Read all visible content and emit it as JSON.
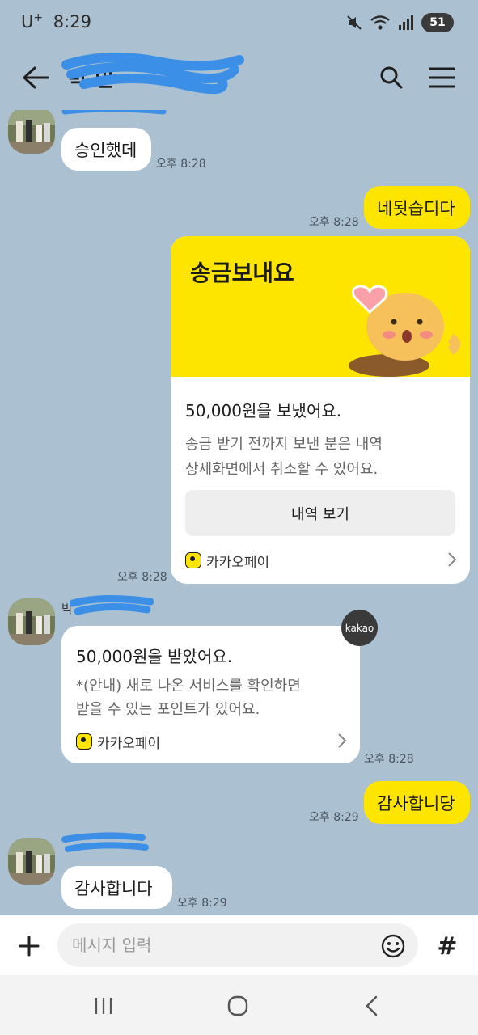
{
  "status_bar": {
    "carrier": "U",
    "carrier_sup": "+",
    "time": "8:29",
    "battery": "51"
  },
  "header": {
    "title": "박 민 "
  },
  "messages": {
    "m1_text": "승인했데",
    "m1_time": "오후 8:28",
    "m2_text": "네됫습디다",
    "m2_time": "오후 8:28",
    "m3_time": "오후 8:28",
    "m4_sender": "박",
    "m4_time": "오후 8:28",
    "m5_text": "감사합니당",
    "m5_time": "오후 8:29",
    "m6_text": "감사합니다",
    "m6_time": "오후 8:29"
  },
  "pay_card": {
    "headline": "송금보내요",
    "amount": "50,000원을 보냈어요.",
    "desc_line1": "송금 받기 전까지 보낸 분은 내역",
    "desc_line2": "상세화면에서 취소할 수 있어요.",
    "button_label": "내역 보기",
    "brand": "카카오페이"
  },
  "recv_card": {
    "badge": "kakao",
    "amount": "50,000원을 받았어요.",
    "desc_line1": "*(안내) 새로 나온 서비스를 확인하면",
    "desc_line2": "받을 수 있는 포인트가 있어요.",
    "brand": "카카오페이"
  },
  "input_bar": {
    "placeholder": "메시지 입력",
    "hash_label": "#"
  },
  "colors": {
    "chat_background": "#abc1d1",
    "outgoing_bubble": "#fee500",
    "incoming_bubble": "#ffffff"
  }
}
